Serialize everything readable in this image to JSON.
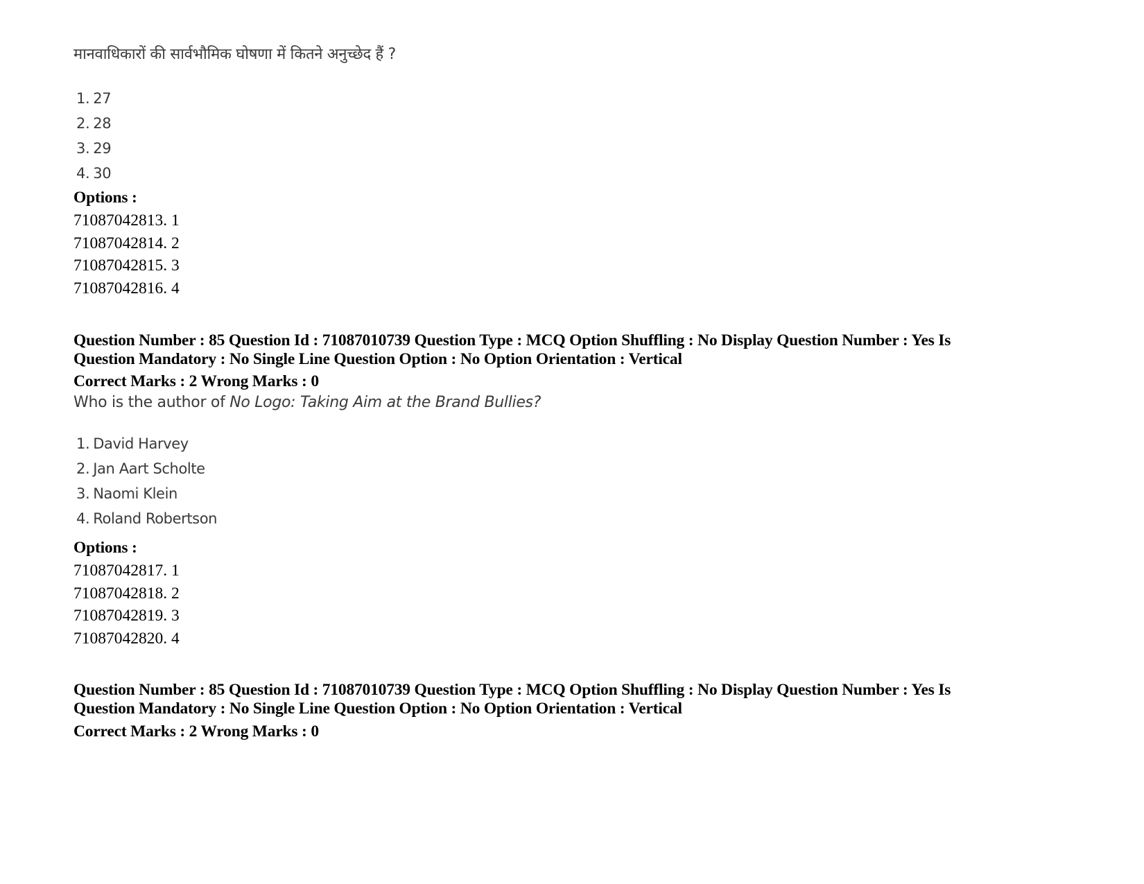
{
  "block1": {
    "question_text": "मानवाधिकारों की सार्वभौमिक घोषणा में कितने अनुच्छेद हैं ?",
    "choices": [
      {
        "num": "1.",
        "text": "27"
      },
      {
        "num": "2.",
        "text": "28"
      },
      {
        "num": "3.",
        "text": "29"
      },
      {
        "num": "4.",
        "text": "30"
      }
    ],
    "options_label": "Options :",
    "options": [
      {
        "id": "71087042813.",
        "value": "1"
      },
      {
        "id": "71087042814.",
        "value": "2"
      },
      {
        "id": "71087042815.",
        "value": "3"
      },
      {
        "id": "71087042816.",
        "value": "4"
      }
    ]
  },
  "block2": {
    "meta_line1": "Question Number : 85 Question Id : 71087010739 Question Type : MCQ Option Shuffling : No Display Question Number : Yes Is",
    "meta_line2": "Question Mandatory : No Single Line Question Option : No Option Orientation : Vertical",
    "marks_line": "Correct Marks : 2 Wrong Marks : 0",
    "question_prefix": "Who is the author of ",
    "question_title": "No Logo: Taking Aim at the Brand Bullies?",
    "choices": [
      {
        "num": "1.",
        "text": "David Harvey"
      },
      {
        "num": "2.",
        "text": "Jan Aart Scholte"
      },
      {
        "num": "3.",
        "text": "Naomi Klein"
      },
      {
        "num": "4.",
        "text": "Roland Robertson"
      }
    ],
    "options_label": "Options :",
    "options": [
      {
        "id": "71087042817.",
        "value": "1"
      },
      {
        "id": "71087042818.",
        "value": "2"
      },
      {
        "id": "71087042819.",
        "value": "3"
      },
      {
        "id": "71087042820.",
        "value": "4"
      }
    ]
  },
  "block3": {
    "meta_line1": "Question Number : 85 Question Id : 71087010739 Question Type : MCQ Option Shuffling : No Display Question Number : Yes Is",
    "meta_line2": "Question Mandatory : No Single Line Question Option : No Option Orientation : Vertical",
    "marks_line": "Correct Marks : 2 Wrong Marks : 0"
  }
}
